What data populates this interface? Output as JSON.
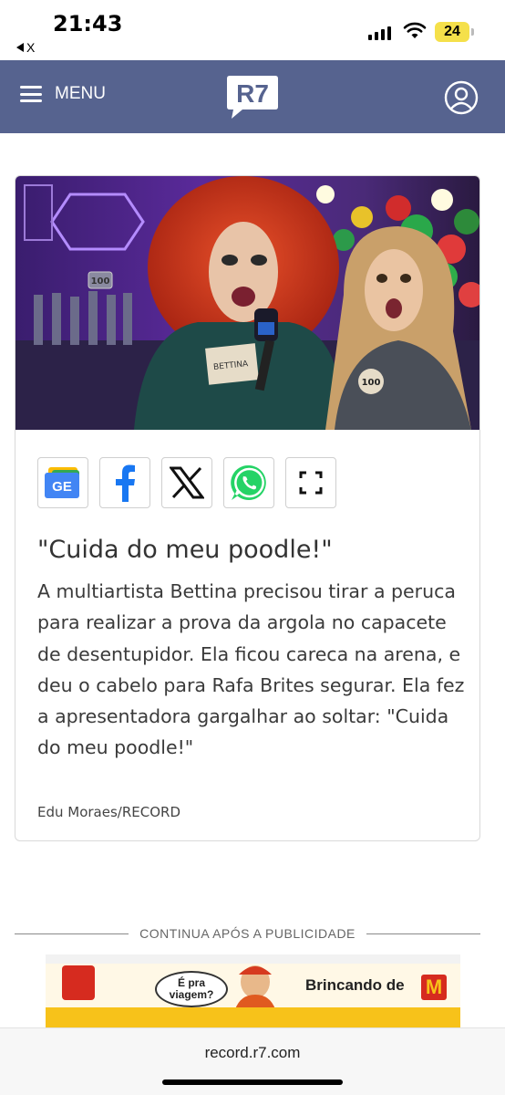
{
  "status_bar": {
    "time": "21:43",
    "back_app": "X",
    "battery": "24"
  },
  "header": {
    "menu_label": "MENU",
    "logo_text": "R7"
  },
  "article": {
    "share_buttons": [
      "google-news",
      "facebook",
      "x",
      "whatsapp",
      "expand"
    ],
    "google_news_label": "GE",
    "headline": "\"Cuida do meu poodle!\"",
    "body": "A multiartista Bettina precisou tirar a peruca para realizar a prova da argola no capacete de desentupidor. Ela ficou careca na arena, e deu o cabelo para Rafa Brites segurar. Ela fez a apresentadora gargalhar ao soltar: \"Cuida do meu poodle!\"",
    "credit": "Edu Moraes/RECORD",
    "photo": {
      "name_tag": "BETTINA",
      "number": "100"
    }
  },
  "ad": {
    "divider_label": "CONTINUA APÓS A PUBLICIDADE",
    "bubble_text": "É pra viagem?",
    "banner_text": "Brincando de",
    "brand_mark": "M"
  },
  "browser": {
    "url": "record.r7.com"
  },
  "colors": {
    "header_bg": "#56638f",
    "card_border": "#d9d9d9",
    "facebook": "#1877f2",
    "whatsapp": "#25d366"
  }
}
